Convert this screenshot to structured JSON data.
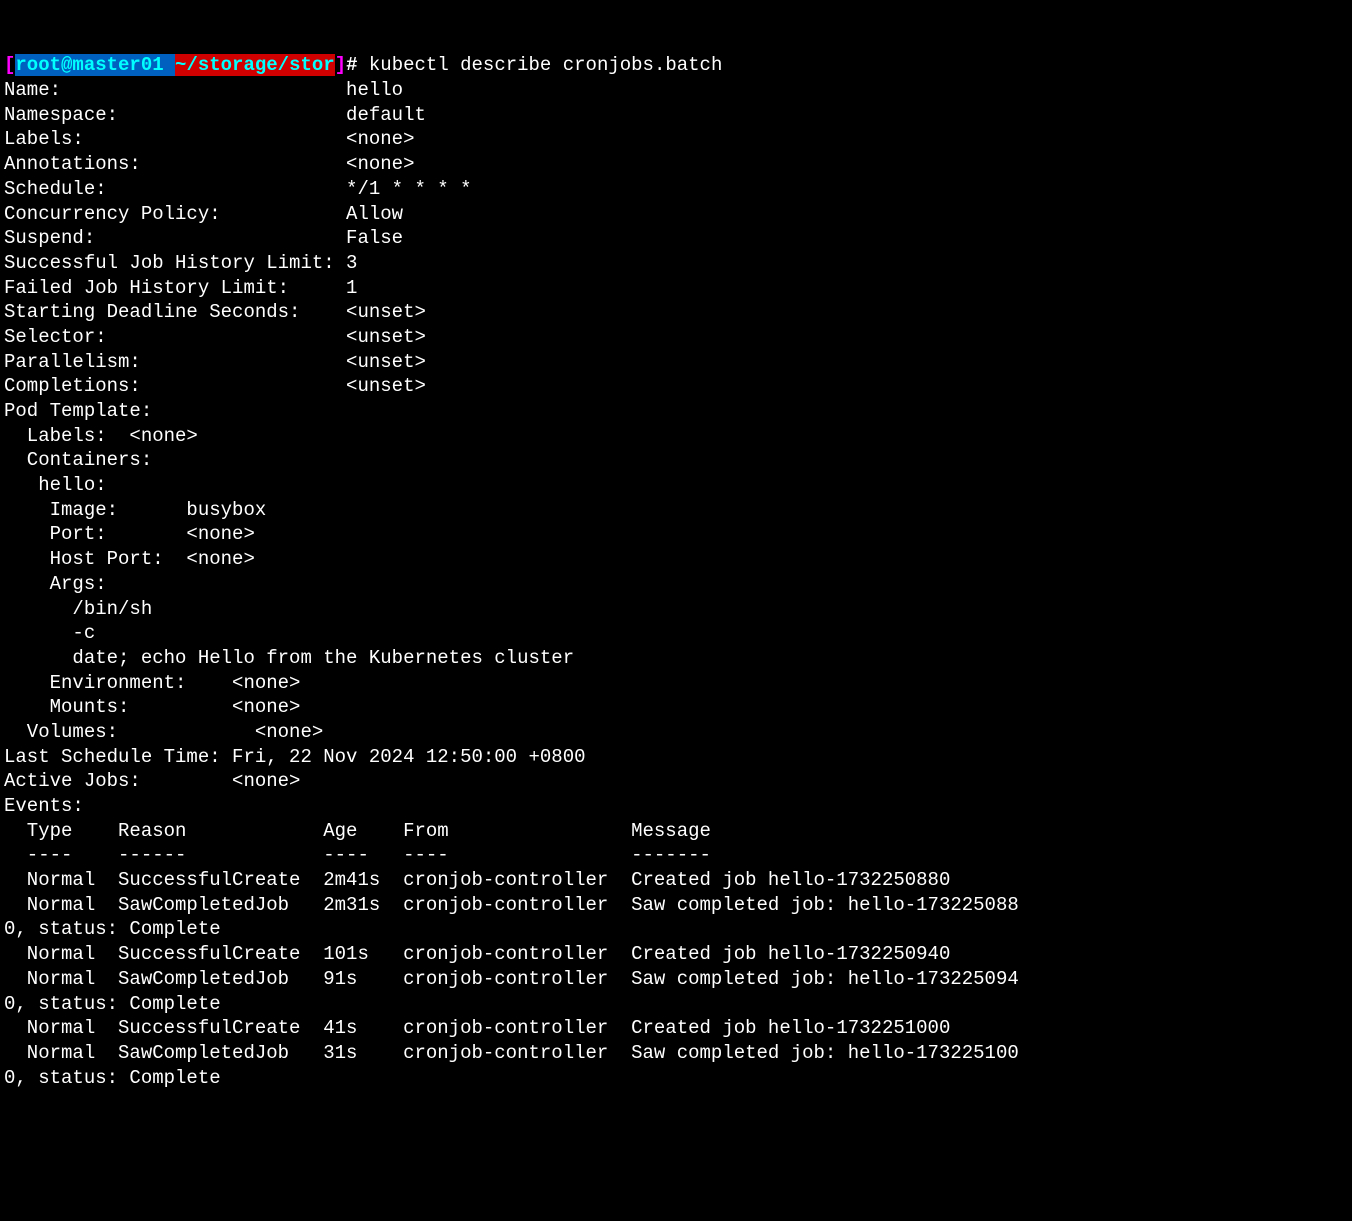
{
  "prompt": {
    "open_bracket": "[",
    "user_host": "root@master01",
    "space": " ",
    "path": "~/storage/stor",
    "close_bracket": "]",
    "hash": "#",
    "command": " kubectl describe cronjobs.batch"
  },
  "fields": [
    {
      "label": "Name:",
      "pad": 30,
      "value": "hello"
    },
    {
      "label": "Namespace:",
      "pad": 30,
      "value": "default"
    },
    {
      "label": "Labels:",
      "pad": 30,
      "value": "<none>"
    },
    {
      "label": "Annotations:",
      "pad": 30,
      "value": "<none>"
    },
    {
      "label": "Schedule:",
      "pad": 30,
      "value": "*/1 * * * *"
    },
    {
      "label": "Concurrency Policy:",
      "pad": 30,
      "value": "Allow"
    },
    {
      "label": "Suspend:",
      "pad": 30,
      "value": "False"
    },
    {
      "label": "Successful Job History Limit:",
      "pad": 30,
      "value": "3"
    },
    {
      "label": "Failed Job History Limit:",
      "pad": 30,
      "value": "1"
    },
    {
      "label": "Starting Deadline Seconds:",
      "pad": 30,
      "value": "<unset>"
    },
    {
      "label": "Selector:",
      "pad": 30,
      "value": "<unset>"
    },
    {
      "label": "Parallelism:",
      "pad": 30,
      "value": "<unset>"
    },
    {
      "label": "Completions:",
      "pad": 30,
      "value": "<unset>"
    }
  ],
  "pod_template_header": "Pod Template:",
  "pod_labels_line": "  Labels:  <none>",
  "containers_header": "  Containers:",
  "container_name": "   hello:",
  "container_fields": [
    {
      "line": "    Image:      busybox"
    },
    {
      "line": "    Port:       <none>"
    },
    {
      "line": "    Host Port:  <none>"
    },
    {
      "line": "    Args:"
    },
    {
      "line": "      /bin/sh"
    },
    {
      "line": "      -c"
    },
    {
      "line": "      date; echo Hello from the Kubernetes cluster"
    },
    {
      "line": "    Environment:    <none>"
    },
    {
      "line": "    Mounts:         <none>"
    }
  ],
  "volumes_line": "  Volumes:            <none>",
  "last_schedule": {
    "label": "Last Schedule Time:",
    "pad": 20,
    "value": "Fri, 22 Nov 2024 12:50:00 +0800"
  },
  "active_jobs": {
    "label": "Active Jobs:",
    "pad": 20,
    "value": "<none>"
  },
  "events_header": "Events:",
  "events_columns": {
    "type": "Type",
    "reason": "Reason",
    "age": "Age",
    "from": "From",
    "message": "Message"
  },
  "events_dashes": {
    "type": "----",
    "reason": "------",
    "age": "----",
    "from": "----",
    "message": "-------"
  },
  "events": [
    {
      "type": "Normal",
      "reason": "SuccessfulCreate",
      "age": "2m41s",
      "from": "cronjob-controller",
      "message": "Created job hello-1732250880"
    },
    {
      "type": "Normal",
      "reason": "SawCompletedJob",
      "age": "2m31s",
      "from": "cronjob-controller",
      "message": "Saw completed job: hello-1732250880, status: Complete"
    },
    {
      "type": "Normal",
      "reason": "SuccessfulCreate",
      "age": "101s",
      "from": "cronjob-controller",
      "message": "Created job hello-1732250940"
    },
    {
      "type": "Normal",
      "reason": "SawCompletedJob",
      "age": "91s",
      "from": "cronjob-controller",
      "message": "Saw completed job: hello-1732250940, status: Complete"
    },
    {
      "type": "Normal",
      "reason": "SuccessfulCreate",
      "age": "41s",
      "from": "cronjob-controller",
      "message": "Created job hello-1732251000"
    },
    {
      "type": "Normal",
      "reason": "SawCompletedJob",
      "age": "31s",
      "from": "cronjob-controller",
      "message": "Saw completed job: hello-1732251000, status: Complete"
    }
  ],
  "event_col_widths": {
    "indent": 2,
    "type": 8,
    "reason": 18,
    "age": 7,
    "from": 20,
    "wrap": 89
  }
}
